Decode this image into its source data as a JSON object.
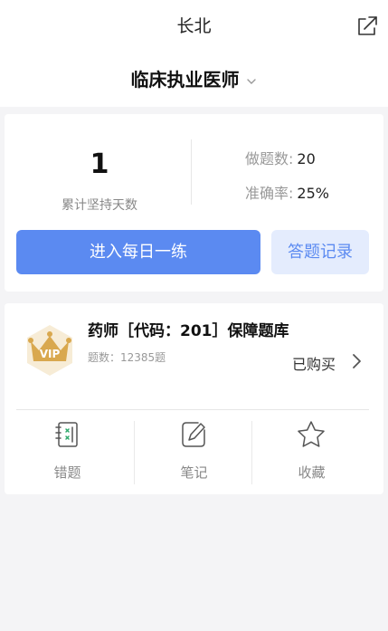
{
  "header": {
    "title": "长北",
    "exam_name": "临床执业医师"
  },
  "stats": {
    "streak_days": "1",
    "streak_label": "累计坚持天数",
    "questions_done_label": "做题数:",
    "questions_done_value": "20",
    "accuracy_label": "准确率:",
    "accuracy_value": "25%"
  },
  "actions": {
    "daily_practice": "进入每日一练",
    "answer_record": "答题记录"
  },
  "question_bank": {
    "badge_text": "VIP",
    "title": "药师［代码：201］保障题库",
    "count": "题数：12385题",
    "status": "已购买"
  },
  "tools": [
    {
      "label": "错题",
      "icon": "wrong-questions-icon"
    },
    {
      "label": "笔记",
      "icon": "notes-icon"
    },
    {
      "label": "收藏",
      "icon": "favorites-icon"
    }
  ],
  "colors": {
    "primary": "#5b8af1",
    "primary_light": "#e4ecfd",
    "vip_gold": "#d9a84e"
  }
}
